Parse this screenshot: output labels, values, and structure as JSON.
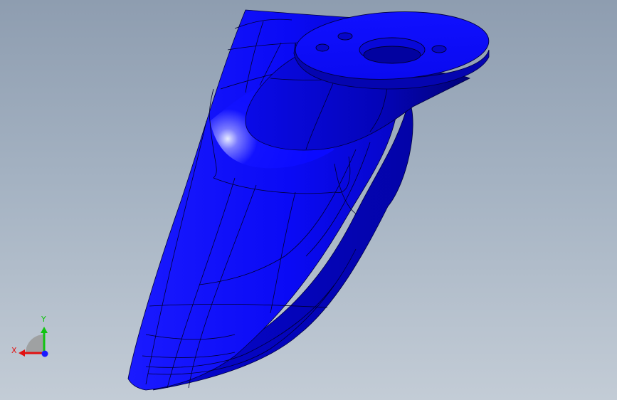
{
  "viewport": {
    "background_top": "#8e9db0",
    "background_bottom": "#c3ccd6",
    "model_color": "#0a0aff",
    "edge_color": "#000030"
  },
  "triad": {
    "x_label": "X",
    "y_label": "Y",
    "x_color": "#e11111",
    "y_color": "#11c411",
    "z_color": "#1a1aff",
    "plane_color": "#9a9a9a"
  }
}
